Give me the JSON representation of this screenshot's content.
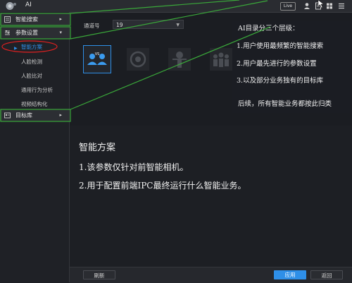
{
  "topbar": {
    "title": "AI",
    "live_label": "Live",
    "icons": [
      "user-icon",
      "document-icon",
      "grid-icon",
      "menu-icon"
    ]
  },
  "sidebar": {
    "items": [
      {
        "label": "智能搜索",
        "icon": "search-icon",
        "arrow": "▸"
      },
      {
        "label": "参数设置",
        "icon": "settings-icon",
        "arrow": "▾"
      },
      {
        "label": "目标库",
        "icon": "database-icon",
        "arrow": "▸"
      }
    ],
    "subitems": [
      {
        "label": "智能方案",
        "active": true
      },
      {
        "label": "人脸检测"
      },
      {
        "label": "人脸比对"
      },
      {
        "label": "通用行为分析"
      },
      {
        "label": "视频结构化"
      }
    ]
  },
  "channel": {
    "label": "通道号",
    "value": "19"
  },
  "schemes": [
    "face-compare-icon",
    "camera-icon",
    "person-icon",
    "crowd-icon"
  ],
  "notes": {
    "title": "AI目录分三个层级：",
    "lines": [
      "1.用户使用最频繁的智能搜索",
      "2.用户最先进行的参数设置",
      "3.以及部分业务独有的目标库"
    ],
    "footer": "后续，所有智能业务都按此归类"
  },
  "description": {
    "heading": "智能方案",
    "lines": [
      "1.该参数仅针对前智能相机。",
      "2.用于配置前端IPC最终运行什么智能业务。"
    ]
  },
  "buttons": {
    "refresh": "刷新",
    "apply": "应用",
    "back": "返回"
  },
  "colors": {
    "accent": "#2e8fe8",
    "highlight": "#3aa83a",
    "annotation": "#e02020"
  }
}
